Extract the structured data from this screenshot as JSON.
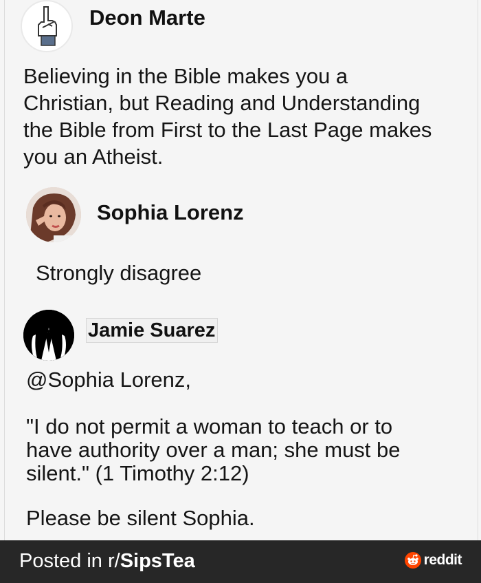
{
  "posts": [
    {
      "author": "Deon Marte",
      "lines": [
        "Believing in the Bible makes you a",
        "Christian, but Reading and Understanding",
        "the Bible from First to the Last Page makes",
        "you an Atheist."
      ]
    },
    {
      "author": "Sophia Lorenz",
      "text": "Strongly disagree"
    },
    {
      "author": "Jamie Suarez",
      "mention": "@Sophia Lorenz,",
      "quote_lines": [
        "\"I do not permit a woman to teach or to",
        "have authority over a man; she must be",
        "silent.\"  (1 Timothy 2:12)"
      ],
      "reply": "Please be silent Sophia."
    }
  ],
  "footer": {
    "prefix": "Posted in r/",
    "subreddit": "SipsTea",
    "brand": "reddit",
    "brand_icon": "reddit-alien-icon"
  },
  "colors": {
    "background": "#f5f5f5",
    "footer": "#272727",
    "reddit_orange": "#ff4500"
  }
}
